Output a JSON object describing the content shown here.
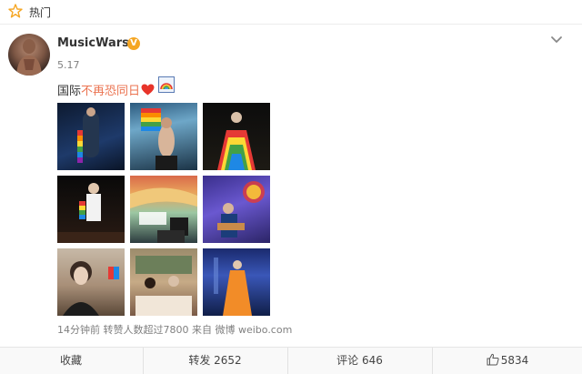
{
  "topbar": {
    "label": "热门",
    "icon": "star-icon"
  },
  "post": {
    "username": "MusicWars",
    "verified_badge": "V",
    "date": "5.17",
    "text_prefix": "国际",
    "text_highlight": "不再恐同日",
    "meta": "14分钟前 转赞人数超过7800 来自 微博 weibo.com",
    "images": [
      "photo-1",
      "photo-2",
      "photo-3",
      "photo-4",
      "photo-5",
      "photo-6",
      "photo-7",
      "photo-8",
      "photo-9"
    ]
  },
  "actions": {
    "favorite": "收藏",
    "repost": "转发 2652",
    "comment": "评论 646",
    "like": "5834"
  },
  "colors": {
    "highlight": "#eb7350",
    "heart": "#e8342a",
    "verified": "#f5a623",
    "star": "#f5a623"
  }
}
